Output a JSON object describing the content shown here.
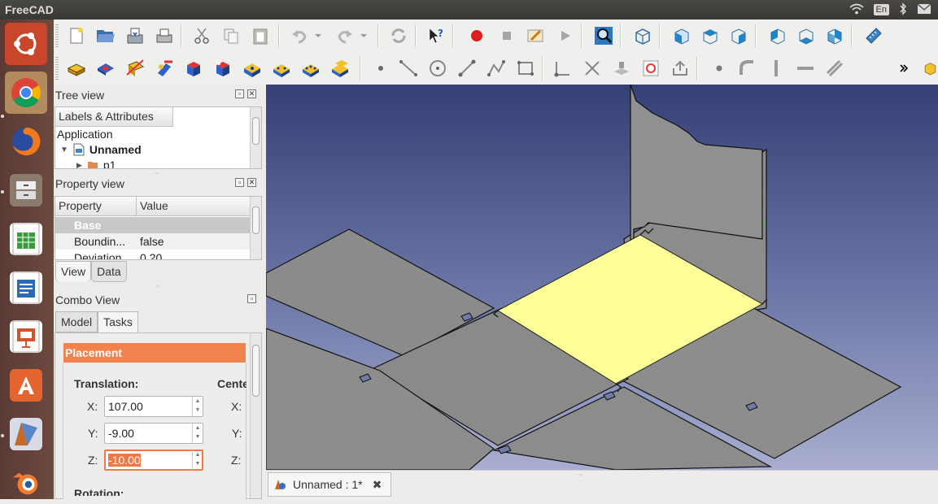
{
  "app": {
    "title": "FreeCAD"
  },
  "tray": {
    "lang": "En"
  },
  "tree_view": {
    "title": "Tree view",
    "column": "Labels & Attributes",
    "application_label": "Application",
    "document": "Unnamed",
    "child": "p1"
  },
  "property_view": {
    "title": "Property view",
    "headers": {
      "property": "Property",
      "value": "Value"
    },
    "group": "Base",
    "rows": [
      {
        "name": "Boundin...",
        "value": "false"
      },
      {
        "name": "Deviation",
        "value": "0.20"
      }
    ],
    "tabs": [
      "View",
      "Data"
    ]
  },
  "combo_view": {
    "title": "Combo View",
    "tabs": [
      "Model",
      "Tasks"
    ]
  },
  "placement": {
    "header": "Placement",
    "translation_label": "Translation:",
    "center_label": "Cente",
    "x_label": "X:",
    "y_label": "Y:",
    "z_label": "Z:",
    "x": "107.00",
    "y": "-9.00",
    "z": "-10.00",
    "rotation_label": "Rotation:"
  },
  "document_tab": {
    "label": "Unnamed : 1*"
  },
  "colors": {
    "accent": "#f0824e",
    "selection": "#ffff99"
  }
}
